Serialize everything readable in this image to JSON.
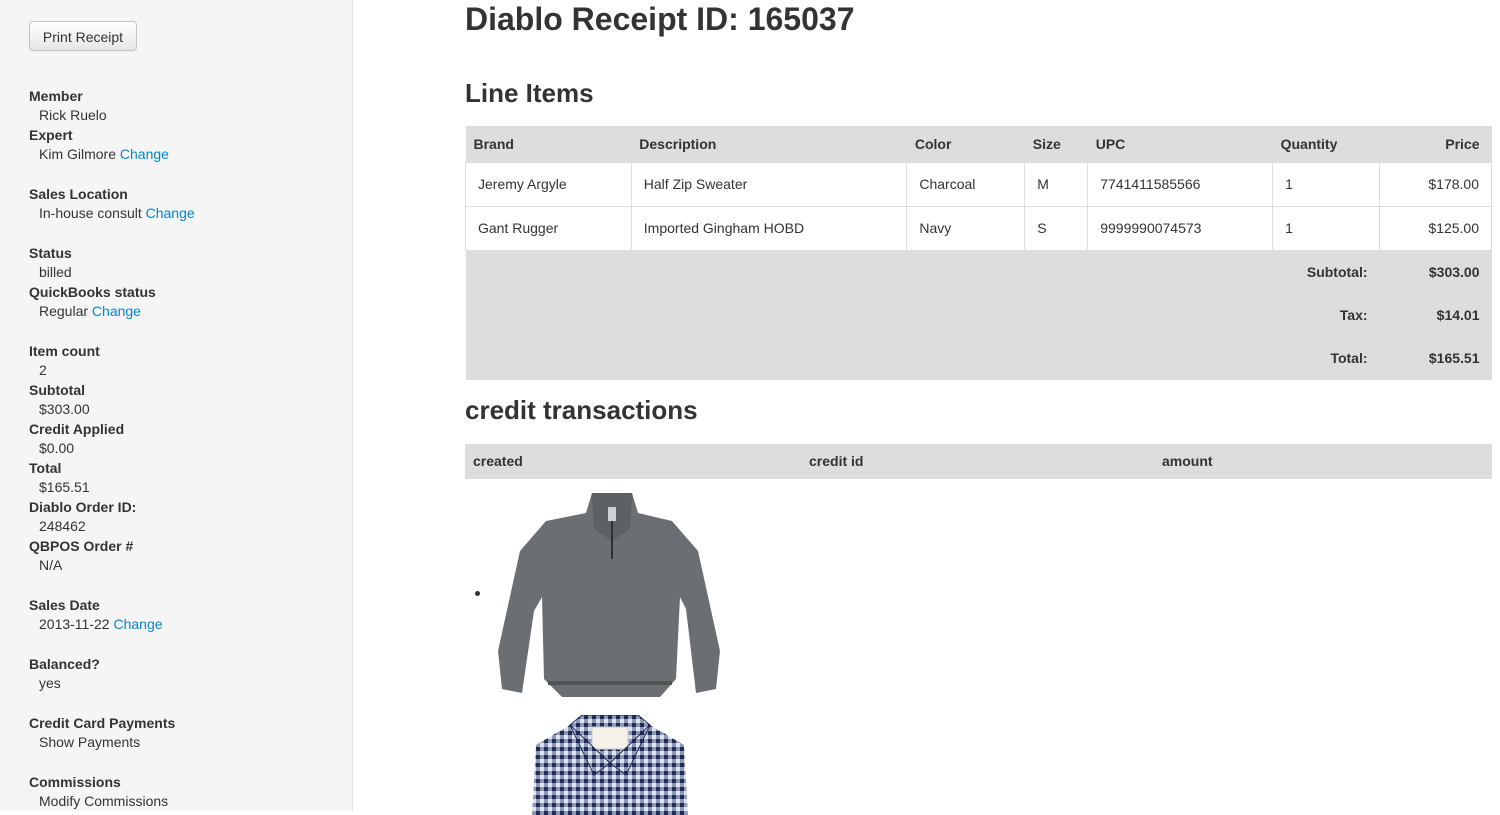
{
  "sidebar": {
    "print_button": "Print Receipt",
    "member_label": "Member",
    "member_name": "Rick Ruelo",
    "expert_label": "Expert",
    "expert_name": "Kim Gilmore",
    "change_label": "Change",
    "sales_location_label": "Sales Location",
    "sales_location_value": "In-house consult",
    "status_label": "Status",
    "status_value": "billed",
    "qb_status_label": "QuickBooks status",
    "qb_status_value": "Regular",
    "item_count_label": "Item count",
    "item_count_value": "2",
    "subtotal_label": "Subtotal",
    "subtotal_value": "$303.00",
    "credit_applied_label": "Credit Applied",
    "credit_applied_value": "$0.00",
    "total_label": "Total",
    "total_value": "$165.51",
    "order_id_label": "Diablo Order ID:",
    "order_id_value": "248462",
    "qbpos_label": "QBPOS Order #",
    "qbpos_value": "N/A",
    "sales_date_label": "Sales Date",
    "sales_date_value": "2013-11-22",
    "balanced_label": "Balanced?",
    "balanced_value": "yes",
    "cc_payments_label": "Credit Card Payments",
    "show_payments": "Show Payments",
    "commissions_label": "Commissions",
    "modify_commissions": "Modify Commissions"
  },
  "main": {
    "title": "Diablo Receipt ID: 165037",
    "line_items_heading": "Line Items",
    "columns": {
      "brand": "Brand",
      "description": "Description",
      "color": "Color",
      "size": "Size",
      "upc": "UPC",
      "quantity": "Quantity",
      "price": "Price"
    },
    "rows": [
      {
        "brand": "Jeremy Argyle",
        "description": "Half Zip Sweater",
        "color": "Charcoal",
        "size": "M",
        "upc": "7741411585566",
        "quantity": "1",
        "price": "$178.00"
      },
      {
        "brand": "Gant Rugger",
        "description": "Imported Gingham HOBD",
        "color": "Navy",
        "size": "S",
        "upc": "9999990074573",
        "quantity": "1",
        "price": "$125.00"
      }
    ],
    "summary": {
      "subtotal_label": "Subtotal:",
      "subtotal_value": "$303.00",
      "tax_label": "Tax:",
      "tax_value": "$14.01",
      "total_label": "Total:",
      "total_value": "$165.51"
    },
    "credit_heading": "credit transactions",
    "credit_columns": {
      "created": "created",
      "credit_id": "credit id",
      "amount": "amount"
    }
  },
  "colors": {
    "link": "#0088cc",
    "header_bg": "#dddddd",
    "sidebar_bg": "#f5f5f5",
    "sweater": "#6b6e72",
    "gingham": "#2d3d6b"
  },
  "icons": [
    "sweater-image",
    "gingham-shirt-image",
    "list-bullet-icon"
  ]
}
